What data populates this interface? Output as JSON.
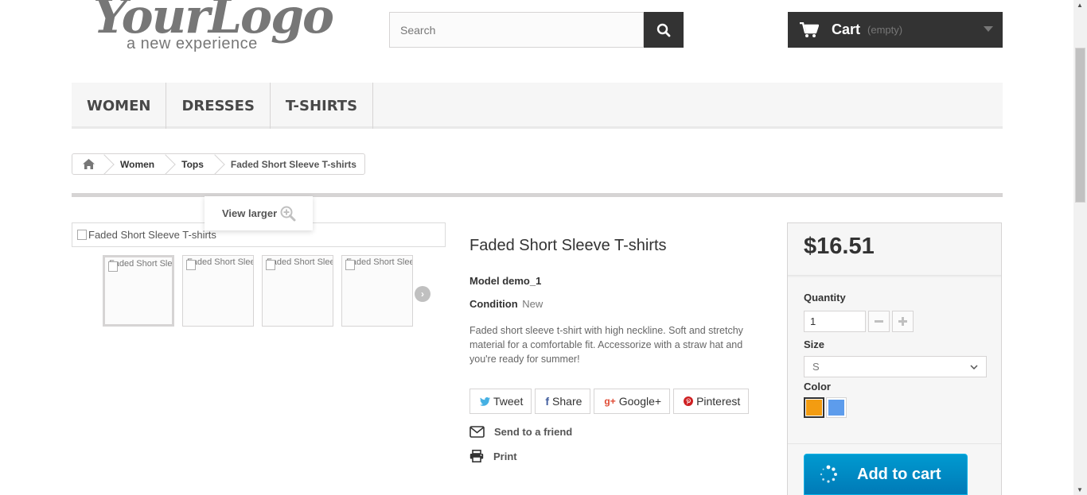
{
  "header": {
    "logo_main": "YourLogo",
    "logo_sub": "a new experience",
    "search_placeholder": "Search",
    "cart_label": "Cart",
    "cart_status": "(empty)"
  },
  "menu": {
    "items": [
      "WOMEN",
      "DRESSES",
      "T-SHIRTS"
    ]
  },
  "breadcrumb": {
    "items": [
      "Women",
      "Tops"
    ],
    "current": "Faded Short Sleeve T-shirts"
  },
  "gallery": {
    "view_larger": "View larger",
    "main_alt": "Faded Short Sleeve T-shirts",
    "thumb_alt": "Faded Short Sleeve T-shirts"
  },
  "product": {
    "title": "Faded Short Sleeve T-shirts",
    "model_label": "Model",
    "model_value": "demo_1",
    "condition_label": "Condition",
    "condition_value": "New",
    "description": "Faded short sleeve t-shirt with high neckline. Soft and stretchy material for a comfortable fit. Accessorize with a straw hat and you're ready for summer!"
  },
  "social": {
    "tweet": "Tweet",
    "share": "Share",
    "google": "Google+",
    "pinterest": "Pinterest",
    "google_icon": "g+"
  },
  "links": {
    "send_friend": "Send to a friend",
    "print": "Print"
  },
  "buy_box": {
    "price": "$16.51",
    "quantity_label": "Quantity",
    "quantity_value": "1",
    "size_label": "Size",
    "size_value": "S",
    "color_label": "Color",
    "colors": [
      "#f39c11",
      "#5d9cec"
    ],
    "add_to_cart": "Add to cart"
  }
}
